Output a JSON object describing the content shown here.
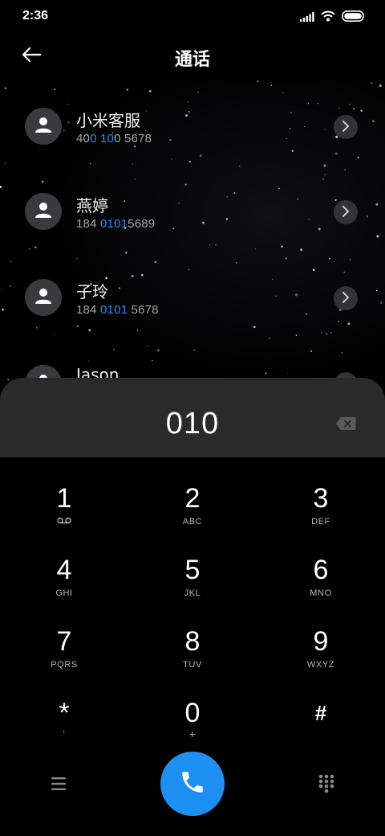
{
  "status_bar": {
    "time": "2:36",
    "icons": [
      "signal-icon",
      "wifi-icon",
      "battery-icon"
    ]
  },
  "header": {
    "title": "通话",
    "back_icon": "arrow-left-icon"
  },
  "contacts": [
    {
      "name": "小米客服",
      "number_parts": [
        "400",
        " ",
        "10",
        "0",
        " 5678"
      ],
      "highlight": [
        false,
        false,
        true,
        false,
        false
      ]
    },
    {
      "name": "燕婷",
      "number_parts": [
        "184 ",
        "0101",
        "5689"
      ],
      "highlight": [
        false,
        true,
        false
      ]
    },
    {
      "name": "子玲",
      "number_parts": [
        "184 ",
        "0101",
        " 5678"
      ],
      "highlight": [
        false,
        true,
        false
      ]
    },
    {
      "name": "Jason"
    }
  ],
  "contact_number_text": {
    "c0": {
      "a": "40",
      "b": "0",
      "c": " ",
      "d": "10",
      "e": "0 5678"
    },
    "c1": {
      "a": "184 ",
      "b": "0101",
      "c": "5689"
    },
    "c2": {
      "a": "184 ",
      "b": "0101",
      "c": " 5678"
    }
  },
  "dialer": {
    "entered_number": "010",
    "keys": [
      {
        "digit": "1",
        "letters": ""
      },
      {
        "digit": "2",
        "letters": "ABC"
      },
      {
        "digit": "3",
        "letters": "DEF"
      },
      {
        "digit": "4",
        "letters": "GHI"
      },
      {
        "digit": "5",
        "letters": "JKL"
      },
      {
        "digit": "6",
        "letters": "MNO"
      },
      {
        "digit": "7",
        "letters": "PQRS"
      },
      {
        "digit": "8",
        "letters": "TUV"
      },
      {
        "digit": "9",
        "letters": "WXYZ"
      },
      {
        "digit": "*",
        "letters": ","
      },
      {
        "digit": "0",
        "letters": "+"
      },
      {
        "digit": "#",
        "letters": ""
      }
    ]
  },
  "colors": {
    "accent": "#1e8ff3",
    "highlight_text": "#2b8cf0",
    "panel": "#2a2a2a",
    "avatar": "#3a3a3d"
  }
}
